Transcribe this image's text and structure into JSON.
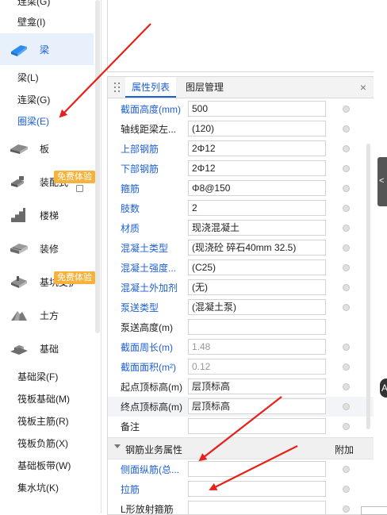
{
  "sidebar": {
    "top_items": [
      {
        "label": "连梁(G)"
      },
      {
        "label": "壁龛(I)"
      }
    ],
    "sub_beam": [
      {
        "label": "梁(L)"
      },
      {
        "label": "连梁(G)"
      },
      {
        "label": "圈梁(E)"
      }
    ],
    "categories": [
      {
        "label": "梁",
        "icon": "beam-icon"
      },
      {
        "label": "板",
        "icon": "slab-icon"
      },
      {
        "label": "装配式",
        "icon": "prefab-icon"
      },
      {
        "label": "楼梯",
        "icon": "stairs-icon"
      },
      {
        "label": "装修",
        "icon": "decoration-icon"
      },
      {
        "label": "基坑支护",
        "icon": "pit-support-icon"
      },
      {
        "label": "土方",
        "icon": "earthwork-icon"
      },
      {
        "label": "基础",
        "icon": "foundation-icon"
      }
    ],
    "badges": [
      "免费体验",
      "免费体验"
    ],
    "foundation_items": [
      {
        "label": "基础梁(F)"
      },
      {
        "label": "筏板基础(M)"
      },
      {
        "label": "筏板主筋(R)"
      },
      {
        "label": "筏板负筋(X)"
      },
      {
        "label": "基础板带(W)"
      },
      {
        "label": "集水坑(K)"
      }
    ]
  },
  "panel": {
    "tabs": [
      {
        "label": "属性列表"
      },
      {
        "label": "图层管理"
      }
    ],
    "close_label": "×",
    "rows": [
      {
        "key": "截面高度(mm)",
        "value": "500",
        "link": true
      },
      {
        "key": "轴线距梁左...",
        "value": "(120)",
        "link": false
      },
      {
        "key": "上部钢筋",
        "value": "2Φ12",
        "link": true
      },
      {
        "key": "下部钢筋",
        "value": "2Φ12",
        "link": true
      },
      {
        "key": "箍筋",
        "value": "Φ8@150",
        "link": true
      },
      {
        "key": "肢数",
        "value": "2",
        "link": true
      },
      {
        "key": "材质",
        "value": "现浇混凝土",
        "link": true
      },
      {
        "key": "混凝土类型",
        "value": "(现浇砼 碎石40mm 32.5)",
        "link": true
      },
      {
        "key": "混凝土强度...",
        "value": "(C25)",
        "link": true
      },
      {
        "key": "混凝土外加剂",
        "value": "(无)",
        "link": true
      },
      {
        "key": "泵送类型",
        "value": "(混凝土泵)",
        "link": true
      },
      {
        "key": "泵送高度(m)",
        "value": "",
        "link": false
      },
      {
        "key": "截面周长(m)",
        "value": "1.48",
        "link": true
      },
      {
        "key": "截面面积(m²)",
        "value": "0.12",
        "link": true
      },
      {
        "key": "起点顶标高(m)",
        "value": "层顶标高",
        "link": false
      },
      {
        "key": "终点顶标高(m)",
        "value": "层顶标高",
        "link": false
      },
      {
        "key": "备注",
        "value": "",
        "link": false
      }
    ],
    "section": {
      "title": "钢筋业务属性",
      "right": "附加"
    },
    "sub_rows": [
      {
        "key": "侧面纵筋(总...",
        "value": "",
        "link": true
      },
      {
        "key": "拉筋",
        "value": "",
        "link": true
      },
      {
        "key": "L形放射箍筋",
        "value": "",
        "link": false
      }
    ]
  },
  "right_edge": {
    "letter": "A",
    "tab_glyph": "<"
  },
  "colors": {
    "link": "#1e5fd6",
    "badge": "#f6b23b",
    "selected_bg": "#e8f0fb",
    "arrow": "#e8201a"
  }
}
